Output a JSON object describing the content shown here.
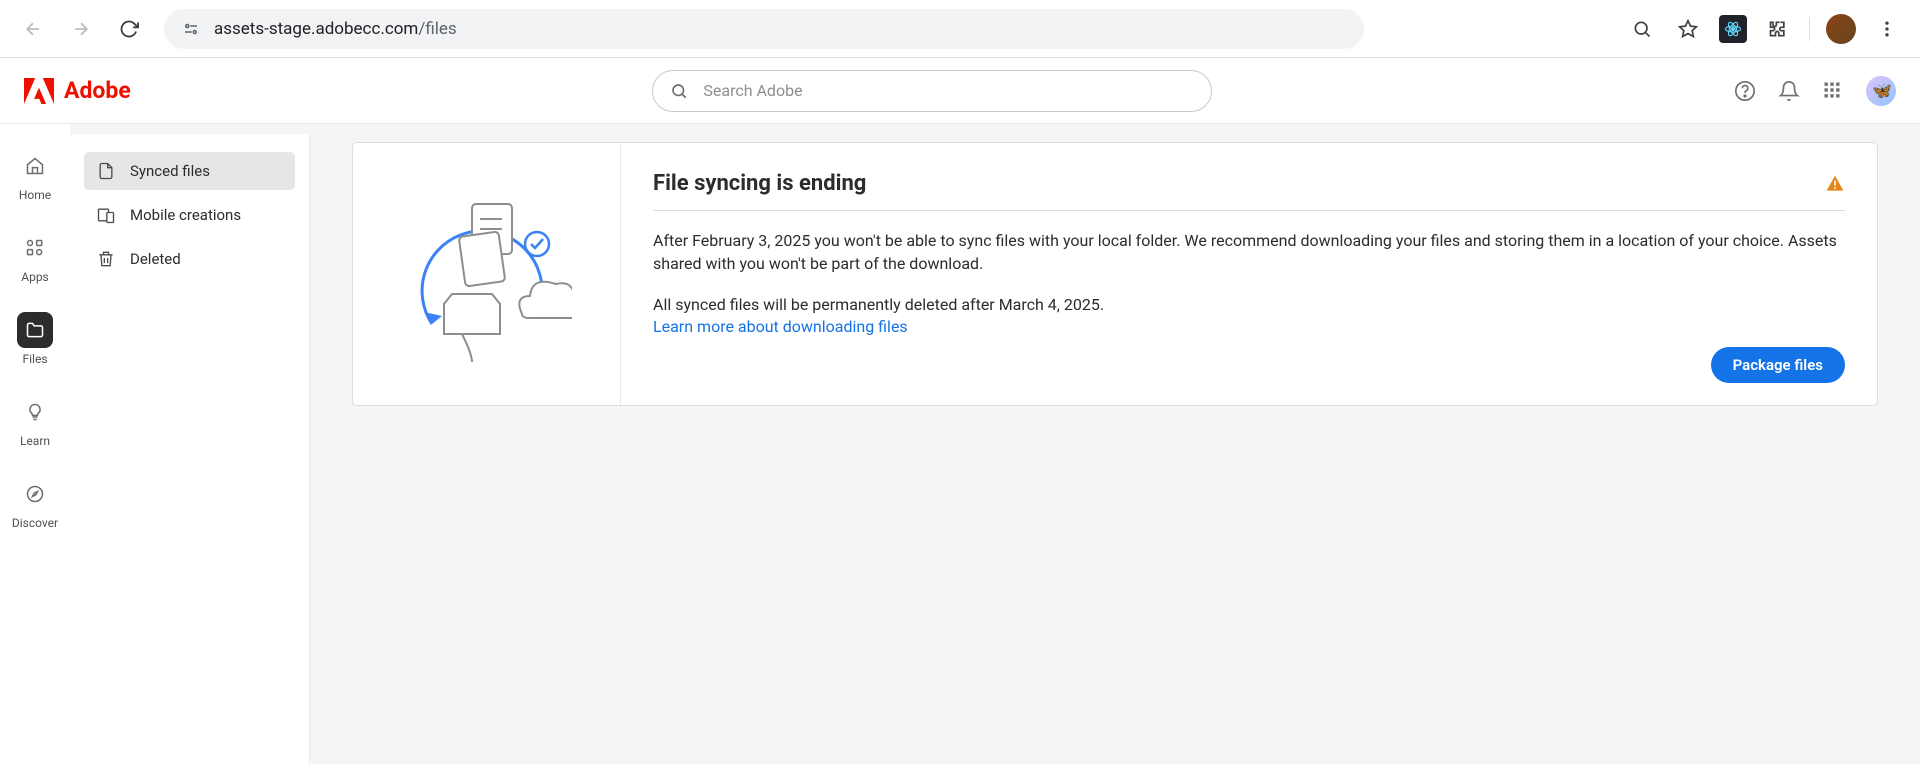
{
  "browser": {
    "url_host": "assets-stage.adobecc.com",
    "url_path": "/files"
  },
  "brand": {
    "name": "Adobe"
  },
  "search": {
    "placeholder": "Search Adobe"
  },
  "rail": {
    "items": [
      {
        "label": "Home"
      },
      {
        "label": "Apps"
      },
      {
        "label": "Files"
      },
      {
        "label": "Learn"
      },
      {
        "label": "Discover"
      }
    ]
  },
  "sidebar": {
    "items": [
      {
        "label": "Synced files"
      },
      {
        "label": "Mobile creations"
      },
      {
        "label": "Deleted"
      }
    ]
  },
  "banner": {
    "title": "File syncing is ending",
    "p1": "After February 3, 2025 you won't be able to sync files with your local folder. We recommend downloading your files and storing them in a location of your choice. Assets shared with you won't be part of the download.",
    "p2": "All synced files will be permanently deleted after March 4, 2025.",
    "link": "Learn more about downloading files",
    "cta": "Package files"
  }
}
